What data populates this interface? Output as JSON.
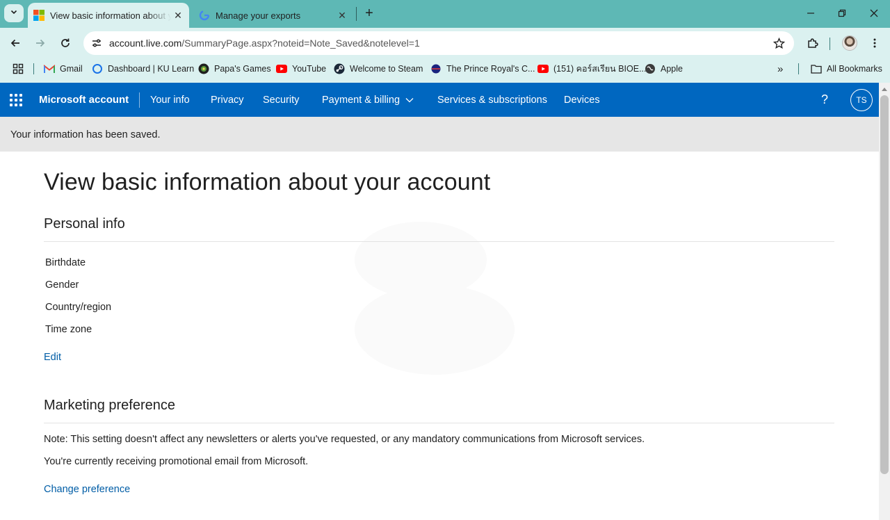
{
  "browser": {
    "tabs": [
      {
        "title": "View basic information about your account",
        "favicon": "microsoft-logo-icon",
        "active": true
      },
      {
        "title": "Manage your exports",
        "favicon": "google-logo-icon",
        "active": false
      }
    ],
    "address": {
      "host": "account.live.com",
      "path": "/SummaryPage.aspx?noteid=Note_Saved&notelevel=1"
    },
    "bookmarks": [
      {
        "label": "Gmail",
        "icon": "gmail-icon"
      },
      {
        "label": "Dashboard | KU Learn",
        "icon": "ku-learn-icon"
      },
      {
        "label": "Papa's Games",
        "icon": "papas-games-icon"
      },
      {
        "label": "YouTube",
        "icon": "youtube-icon"
      },
      {
        "label": "Welcome to Steam",
        "icon": "steam-icon"
      },
      {
        "label": "The Prince Royal's C...",
        "icon": "prince-royal-icon"
      },
      {
        "label": "(151) คอร์สเรียน BIOE...",
        "icon": "youtube-icon"
      },
      {
        "label": "Apple",
        "icon": "apple-globe-icon"
      }
    ],
    "all_bookmarks": "All Bookmarks"
  },
  "header": {
    "brand": "Microsoft account",
    "nav": [
      "Your info",
      "Privacy",
      "Security",
      "Payment & billing",
      "Services & subscriptions",
      "Devices"
    ],
    "help": "?",
    "avatar_initials": "TS",
    "accent": "#0067c0"
  },
  "notice": "Your information has been saved.",
  "page": {
    "title": "View basic information about your account",
    "personal": {
      "heading": "Personal info",
      "fields": [
        "Birthdate",
        "Gender",
        "Country/region",
        "Time zone"
      ],
      "edit": "Edit"
    },
    "marketing": {
      "heading": "Marketing preference",
      "note": "Note: This setting doesn't affect any newsletters or alerts you've requested, or any mandatory communications from Microsoft services.",
      "status": "You're currently receiving promotional email from Microsoft.",
      "change": "Change preference"
    }
  }
}
